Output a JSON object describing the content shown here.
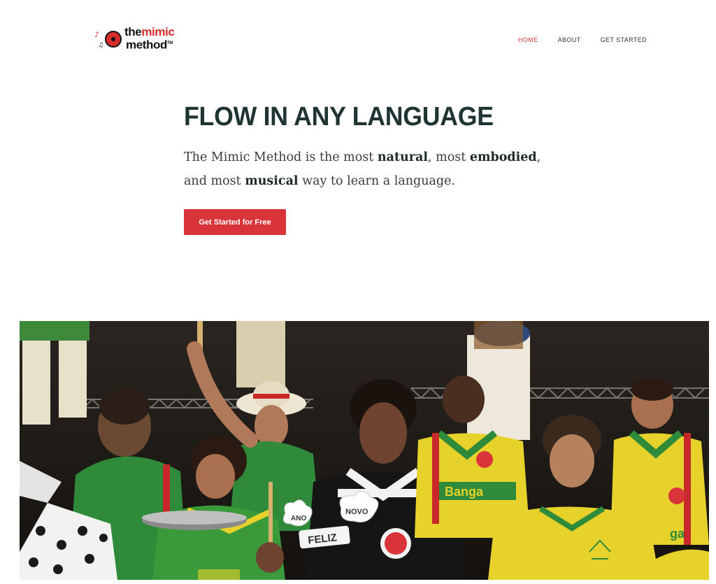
{
  "brand": {
    "logo_the": "the",
    "logo_mimic": "mimic",
    "logo_method": "method",
    "logo_tm": "TM",
    "accent_red": "#d9343a",
    "heading_color": "#1f3433"
  },
  "nav": {
    "items": [
      {
        "label": "HOME",
        "active": true
      },
      {
        "label": "ABOUT",
        "active": false
      },
      {
        "label": "GET STARTED",
        "active": false
      }
    ]
  },
  "hero": {
    "title": "FLOW IN ANY LANGUAGE",
    "subtitle_parts": [
      {
        "text": "The Mimic Method is the most ",
        "bold": false
      },
      {
        "text": "natural",
        "bold": true
      },
      {
        "text": ", most ",
        "bold": false
      },
      {
        "text": "embodied",
        "bold": true
      },
      {
        "text": ", and most ",
        "bold": false
      },
      {
        "text": "musical",
        "bold": true
      },
      {
        "text": " way to learn a language.",
        "bold": false
      }
    ],
    "cta_label": "Get Started for Free"
  },
  "photo": {
    "sign_ano": "ANO",
    "sign_novo": "NOVO",
    "sign_feliz": "FELIZ",
    "shirt_text": "Banga",
    "shirt_text_2": "ga"
  }
}
